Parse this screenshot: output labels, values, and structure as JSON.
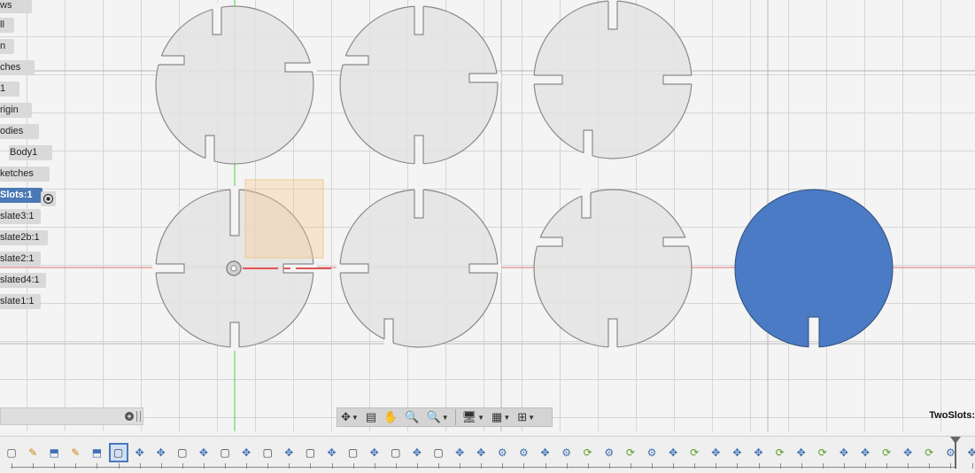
{
  "browser": {
    "nodes": [
      {
        "label": "ws",
        "active": false
      },
      {
        "label": "ll",
        "active": false
      },
      {
        "label": "n",
        "active": false
      },
      {
        "label": "ches",
        "active": false
      },
      {
        "label": "1",
        "active": false
      },
      {
        "label": "rigin",
        "active": false
      },
      {
        "label": "odies",
        "active": false
      },
      {
        "label": "Body1",
        "active": false
      },
      {
        "label": "ketches",
        "active": false
      },
      {
        "label": "Slots:1",
        "active": true
      },
      {
        "label": "slate3:1",
        "active": false
      },
      {
        "label": "slate2b:1",
        "active": false
      },
      {
        "label": "slate2:1",
        "active": false
      },
      {
        "label": "slated4:1",
        "active": false
      },
      {
        "label": "slate1:1",
        "active": false
      }
    ]
  },
  "document": {
    "name": "TwoSlots:"
  },
  "navbar": {
    "items": [
      {
        "name": "orbit-icon",
        "glyph": "✥",
        "caret": true
      },
      {
        "name": "look-at-icon",
        "glyph": "▤",
        "caret": false
      },
      {
        "name": "pan-icon",
        "glyph": "✋",
        "caret": false
      },
      {
        "name": "zoom-icon",
        "glyph": "🔍",
        "caret": false
      },
      {
        "name": "zoom-window-icon",
        "glyph": "🔍",
        "caret": true
      },
      {
        "name": "display-settings-icon",
        "glyph": "🖥",
        "caret": true
      },
      {
        "name": "grid-snap-icon",
        "glyph": "▦",
        "caret": true
      },
      {
        "name": "viewports-icon",
        "glyph": "⊞",
        "caret": true
      }
    ]
  },
  "colors": {
    "selected_body": "#4a7bc4",
    "sketch_fill": "#e3e3e3",
    "axis_green": "#4cd24c",
    "axis_red": "#e25555",
    "tree_active": "#4a79b5"
  },
  "timeline": {
    "items": [
      "sketch",
      "sketch-edit",
      "extrude",
      "sketch-edit",
      "extrude",
      "body",
      "move",
      "move",
      "body",
      "move",
      "body",
      "move",
      "body",
      "move",
      "body",
      "move",
      "body",
      "move",
      "body",
      "move",
      "body",
      "move",
      "move",
      "joint",
      "joint",
      "move",
      "joint",
      "fillet",
      "joint",
      "fillet",
      "joint",
      "move",
      "fillet",
      "move",
      "move",
      "move",
      "fillet",
      "move",
      "fillet",
      "move",
      "move",
      "fillet",
      "move",
      "fillet",
      "joint",
      "move",
      "sketch-edit"
    ],
    "selected_index": 5
  }
}
